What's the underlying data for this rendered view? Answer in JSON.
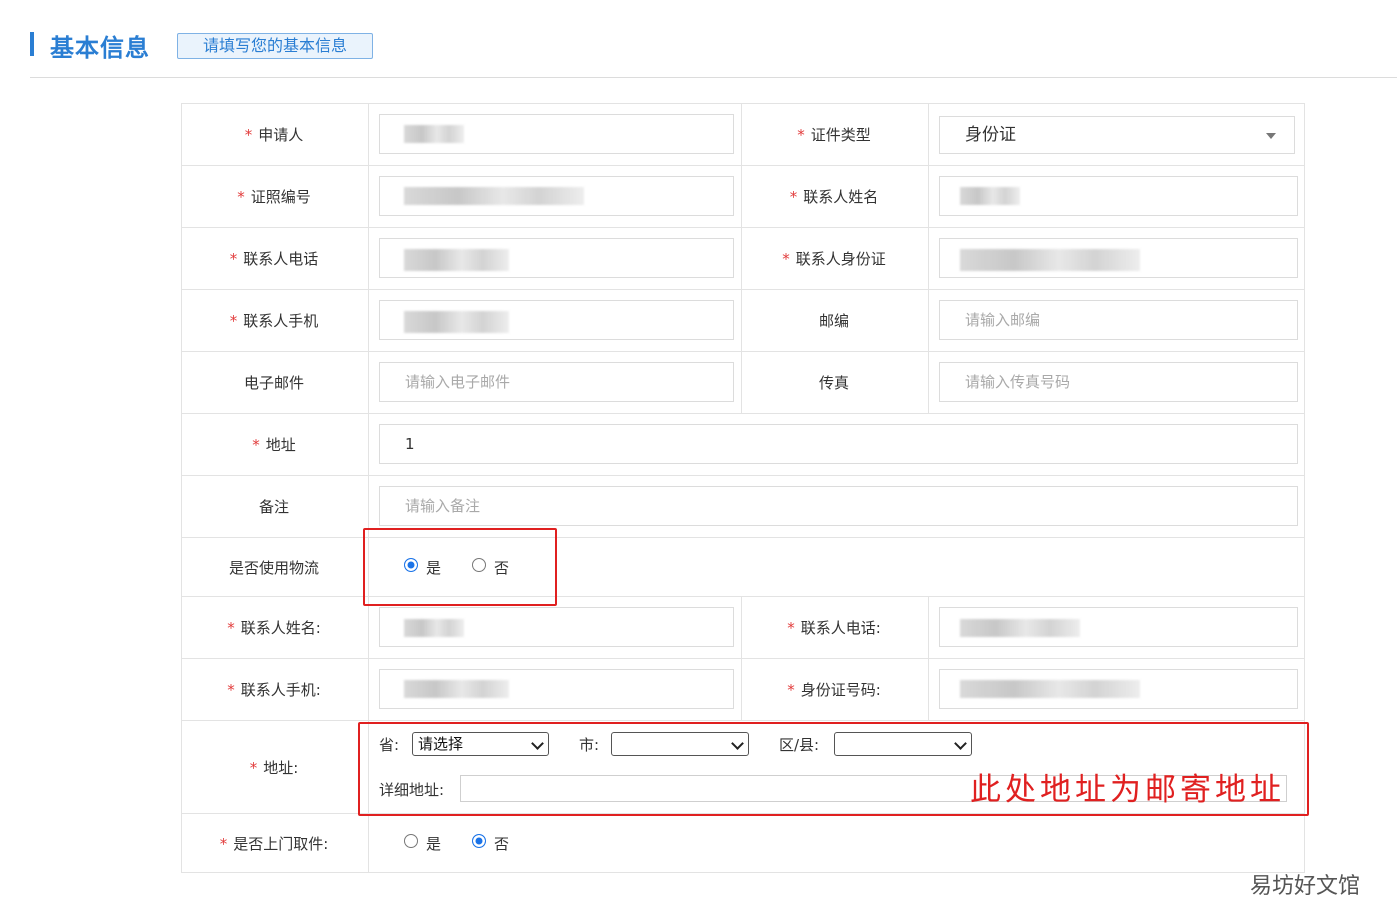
{
  "header": {
    "title": "基本信息",
    "tip": "请填写您的基本信息"
  },
  "rows": {
    "applicant": {
      "label": "申请人"
    },
    "id_type": {
      "label": "证件类型",
      "value": "身份证"
    },
    "license_no": {
      "label": "证照编号"
    },
    "contact_name": {
      "label": "联系人姓名"
    },
    "contact_phone": {
      "label": "联系人电话"
    },
    "contact_id": {
      "label": "联系人身份证"
    },
    "contact_mobile": {
      "label": "联系人手机"
    },
    "postcode": {
      "label": "邮编",
      "placeholder": "请输入邮编"
    },
    "email": {
      "label": "电子邮件",
      "placeholder": "请输入电子邮件"
    },
    "fax": {
      "label": "传真",
      "placeholder": "请输入传真号码"
    },
    "address": {
      "label": "地址",
      "value": "1"
    },
    "remark": {
      "label": "备注",
      "placeholder": "请输入备注"
    },
    "use_logistics": {
      "label": "是否使用物流",
      "yes": "是",
      "no": "否",
      "selected": "是"
    },
    "lg_contact_name": {
      "label": "联系人姓名:"
    },
    "lg_contact_phone": {
      "label": "联系人电话:"
    },
    "lg_contact_mobile": {
      "label": "联系人手机:"
    },
    "lg_id_no": {
      "label": "身份证号码:"
    },
    "lg_address": {
      "label": "地址:",
      "province_label": "省:",
      "province_value": "请选择",
      "city_label": "市:",
      "city_value": "",
      "district_label": "区/县:",
      "district_value": "",
      "detail_label": "详细地址:"
    },
    "door_pickup": {
      "label": "是否上门取件:",
      "yes": "是",
      "no": "否",
      "selected": "否"
    }
  },
  "required_mark": "*",
  "annotation": "此处地址为邮寄地址",
  "watermark": "易坊好文馆",
  "colors": {
    "accent": "#2a7ed3",
    "required": "#e23b3b",
    "annotation": "#e02020",
    "radio_on": "#1a73e8"
  }
}
